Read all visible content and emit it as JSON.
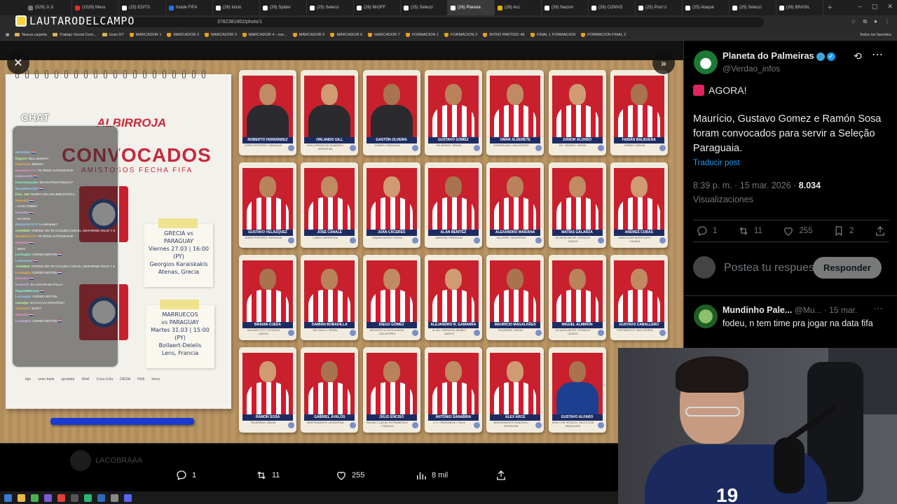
{
  "browser": {
    "tabs": [
      {
        "label": "(529) Ji Ji",
        "icon": "generic"
      },
      {
        "label": "(1529) Mess",
        "icon": "youtube"
      },
      {
        "label": "(25) EDITS",
        "icon": "x"
      },
      {
        "label": "Inside FIFA",
        "icon": "facebook"
      },
      {
        "label": "(26) Inicio",
        "icon": "x"
      },
      {
        "label": "(26) Spider",
        "icon": "x"
      },
      {
        "label": "(25) Selecci",
        "icon": "x"
      },
      {
        "label": "(26) MrOFF",
        "icon": "x"
      },
      {
        "label": "(25) Selecci",
        "icon": "x"
      },
      {
        "label": "(26) Planeta",
        "icon": "x",
        "active": true
      },
      {
        "label": "(26) Acc",
        "icon": "yellow"
      },
      {
        "label": "(26) Nacion",
        "icon": "x"
      },
      {
        "label": "(26) CONVO",
        "icon": "x"
      },
      {
        "label": "(25) Post U",
        "icon": "x"
      },
      {
        "label": "(25) Ataque",
        "icon": "x"
      },
      {
        "label": "(25) Selecci",
        "icon": "x"
      },
      {
        "label": "(26) BRASIL",
        "icon": "x"
      }
    ],
    "new_tab": "+",
    "window_controls": [
      "–",
      "▢",
      "✕"
    ],
    "url_suffix": "3782381862/photo/1",
    "streamer_logo": "LAUTARODELCAMPO",
    "bookmarks": [
      {
        "label": "Nueva carpeta",
        "icon": "folder"
      },
      {
        "label": "Trabajo Social Com...",
        "icon": "folder"
      },
      {
        "label": "Gran DT",
        "icon": "folder"
      },
      {
        "label": "MARCADOR 1",
        "icon": "shield"
      },
      {
        "label": "MARCADOR 2",
        "icon": "shield"
      },
      {
        "label": "MARCADOR 3",
        "icon": "shield"
      },
      {
        "label": "MARCADOR 4 - ove...",
        "icon": "shield"
      },
      {
        "label": "MARCADOR 5",
        "icon": "shield"
      },
      {
        "label": "MARCADOR 6",
        "icon": "shield"
      },
      {
        "label": "MARCADOR 7",
        "icon": "shield"
      },
      {
        "label": "FORMACION 1",
        "icon": "shield"
      },
      {
        "label": "FORMACION 2",
        "icon": "shield"
      },
      {
        "label": "INTRO PARTIDO 4K",
        "icon": "shield"
      },
      {
        "label": "FINAL 1 FORMACION",
        "icon": "shield"
      },
      {
        "label": "FORMACION FINAL 2",
        "icon": "shield"
      }
    ],
    "all_bookmarks": "Todos los favoritos"
  },
  "photo": {
    "notebook_brand": "ALBIRROJA",
    "title": "CONVOCADOS",
    "subtitle": "AMISTOSOS FECHA FIFA",
    "match1": [
      "GRECIA vs",
      "PARAGUAY",
      "Viernes 27.03 | 16:00 (PY)",
      "Georgios Karaiskakis",
      "Atenas, Grecia"
    ],
    "match2": [
      "MARRUECOS",
      "vs PARAGUAY",
      "Martes 31.03 | 15:00 (PY)",
      "Bollaert-Delelis",
      "Lens, Francia"
    ],
    "sponsors": [
      "tigo",
      "ueno bank",
      "apostala",
      "Shell",
      "Coca-Cola",
      "DIESA",
      "NSA",
      "Iveco"
    ],
    "cards": [
      {
        "name": "ROBERTO FERNÁNDEZ",
        "club": "CERRO PORTEÑO / PARAGUAY",
        "kit": "gk"
      },
      {
        "name": "ORLANDO GILL",
        "club": "SAN LORENZO DE ALMAGRO / ARGENTINA",
        "kit": "gk"
      },
      {
        "name": "GASTÓN OLVEIRA",
        "club": "OLIMPIA / PARAGUAY",
        "kit": "gk"
      },
      {
        "name": "GUSTAVO GÓMEZ",
        "club": "PALMEIRAS / BRASIL",
        "kit": "home"
      },
      {
        "name": "OMAR ALDERETE",
        "club": "SUNDERLAND / INGLATERRA",
        "kit": "home"
      },
      {
        "name": "JUNIOR ALONSO",
        "club": "ATL. MINEIRO / BRASIL",
        "kit": "home"
      },
      {
        "name": "FABIÁN BALBUENA",
        "club": "GRÊMIO / BRASIL",
        "kit": "home"
      },
      {
        "name": "GUSTAVO VELÁZQUEZ",
        "club": "CERRO PORTEÑO / PARAGUAY",
        "kit": "home"
      },
      {
        "name": "JOSÉ CANALE",
        "club": "LANÚS / ARGENTINA",
        "kit": "home"
      },
      {
        "name": "JUAN CÁCERES",
        "club": "DINAMO MOSCÚ / RUSIA",
        "kit": "home"
      },
      {
        "name": "ALAN BENÍTEZ",
        "club": "LIBERTAD / PARAGUAY",
        "kit": "home"
      },
      {
        "name": "ALEXANDRO MAIDANA",
        "club": "TALLERES / ARGENTINA",
        "kit": "home"
      },
      {
        "name": "MATÍAS GALARZA",
        "club": "ATLANTA UNITED / ESTADOS UNIDOS",
        "kit": "home"
      },
      {
        "name": "ANDRÉS CUBAS",
        "club": "VANCOUVER WHITECAPS / CANADÁ",
        "kit": "home"
      },
      {
        "name": "BRAIAN OJEDA",
        "club": "ORLANDO CITY / ESTADOS UNIDOS",
        "kit": "home"
      },
      {
        "name": "DAMIÁN BOBADILLA",
        "club": "SÃO PAULO / BRASIL",
        "kit": "home"
      },
      {
        "name": "DIEGO GÓMEZ",
        "club": "BRIGHTON & HOVE ALBION / INGLATERRA",
        "kit": "home"
      },
      {
        "name": "ALEJANDRO R. GAMARRA",
        "club": "AL AIN / EMIRATOS ÁRABES UNIDOS",
        "kit": "home"
      },
      {
        "name": "MAURICIO MAGALHÃES",
        "club": "PALMEIRAS / BRASIL",
        "kit": "home"
      },
      {
        "name": "MIGUEL ALMIRÓN",
        "club": "ATLANTA UNITED / ESTADOS UNIDOS",
        "kit": "home"
      },
      {
        "name": "GUSTAVO CABALLERO",
        "club": "PORTSMOUTH / INGLATERRA",
        "kit": "home"
      },
      {
        "name": "RAMÓN SOSA",
        "club": "PALMEIRAS / BRASIL",
        "kit": "home"
      },
      {
        "name": "GABRIEL ÁVALOS",
        "club": "INDEPENDIENTE / ARGENTINA",
        "kit": "home"
      },
      {
        "name": "JULIO ENCISO",
        "club": "RACING CLUB DE ESTRASBURGO / FRANCIA",
        "kit": "home"
      },
      {
        "name": "ANTONIO SANABRIA",
        "club": "U. S. CREMONESE / ITALIA",
        "kit": "home"
      },
      {
        "name": "ALEX ARCE",
        "club": "INDEPENDIENTE RIVADAVIA / ARGENTINA",
        "kit": "home"
      },
      {
        "name": "GUSTAVO ALFARO",
        "club": "DIRECTOR TÉCNICO / SELECCIÓN PARAGUAYA",
        "kit": "coach"
      }
    ]
  },
  "chat": {
    "title": "CHAT",
    "lines": [
      {
        "user": "tuFN3342",
        "text": ": 🇵🇾"
      },
      {
        "user": "fiego24",
        "text": ": bipo cáceres?"
      },
      {
        "user": "Panzeeoo",
        "text": ": BRESH"
      },
      {
        "user": "Brandon1771",
        "text": ": TE PIDIO AUTOGRAFO!"
      },
      {
        "user": "calipso123",
        "text": ": 🇵🇾"
      },
      {
        "user": "Kosomoopolis",
        "text": ": EN UN PROSTIBULO?"
      },
      {
        "user": "BrunoBPerrell",
        "text": ": 🇵🇾"
      },
      {
        "user": "frias_z99",
        "text": ": NUNCA EN UNA BIBLIOTECA"
      },
      {
        "user": "Ramo04",
        "text": ": 🇵🇾"
      },
      {
        "user": "",
        "text": ": ACIN COBRA"
      },
      {
        "user": "Ramo04",
        "text": ": 🇵🇾"
      },
      {
        "user": "",
        "text": ": AD SIGU"
      },
      {
        "user": "Margarito7372",
        "text": ": Le peleaste?"
      },
      {
        "user": "Ariel5825",
        "text": ": GORDO NO TE CAGUES CON EL UNIFORME ROJO Y BLANCO"
      },
      {
        "user": "Brandon1771",
        "text": ": TE PIDIO AUTOGRAFO!"
      },
      {
        "user": "Ramo04",
        "text": ": 🇵🇾"
      },
      {
        "user": "",
        "text": ": WHO"
      },
      {
        "user": "Lechugita",
        "text": ": GORDO BOTON 🇵🇾"
      },
      {
        "user": "Lualvarezz",
        "text": ": 🇵🇾"
      },
      {
        "user": "Ariel5825",
        "text": ": GORDO NO TE CAGUES CON EL UNIFORME ROJO Y BLANCO"
      },
      {
        "user": "Lechugita",
        "text": ": GORDO BOTON 🇵🇾"
      },
      {
        "user": "Ramo04",
        "text": ": 🇵🇾"
      },
      {
        "user": "DraGo31",
        "text": ": EL LUGAR NO FALLA"
      },
      {
        "user": "ilsgunt56brand",
        "text": ": 🇵🇾"
      },
      {
        "user": "Lechugita",
        "text": ": GORDO BOTON"
      },
      {
        "user": "camaigo",
        "text": ": SACAAAAA ESOOOO!!"
      },
      {
        "user": "arorvio01",
        "text": ": WHO?"
      },
      {
        "user": "Ramo04",
        "text": ": 🇵🇾"
      },
      {
        "user": "Lechugita",
        "text": ": GORDO BOTON 🇵🇾"
      }
    ]
  },
  "bottom_bar": {
    "ghost_user": "LACOBRAAA",
    "ghost_reply": "Postea tu respuesta",
    "ghost_button": "Responder",
    "replies": "1",
    "reposts": "11",
    "likes": "255",
    "views": "8 mil"
  },
  "post": {
    "author_name": "Planeta do Palmeiras",
    "author_handle": "@Verdao_infos",
    "headline": "AGORA!",
    "body": "Maurício, Gustavo Gomez e Ramón Sosa foram convocados para servir a Seleção Paraguaia.",
    "translate": "Traducir post",
    "timestamp": "8:39 p. m. · 15 mar. 2026 · ",
    "views_count": "8.034",
    "views_label": "Visualizaciones",
    "replies": "1",
    "reposts": "11",
    "likes": "255",
    "bookmarks": "2",
    "reply_placeholder": "Postea tu respuesta",
    "reply_button": "Responder"
  },
  "reply": {
    "author_name": "Mundinho Pale...",
    "meta": "@Mu... · 15 mar.",
    "text": "fodeu, n tem time pra jogar na data fifa"
  },
  "webcam": {
    "jersey_number": "19"
  },
  "colors": {
    "x_blue": "#1d9bf0",
    "paraguay_red": "#c8202d",
    "paraguay_navy": "#1c2c62"
  }
}
